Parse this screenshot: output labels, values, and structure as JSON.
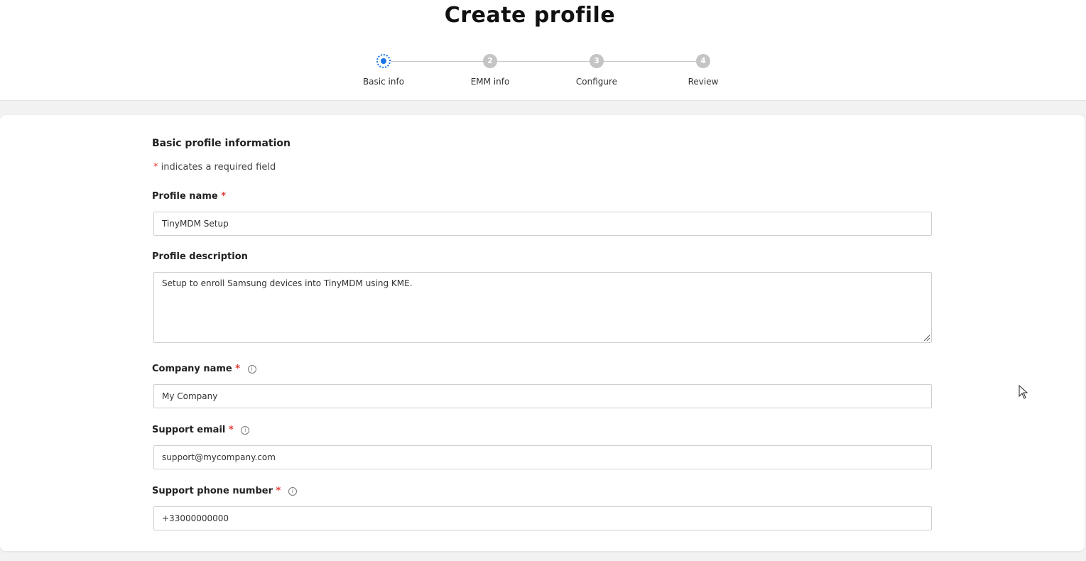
{
  "header": {
    "title": "Create profile"
  },
  "stepper": {
    "steps": [
      {
        "number": "1",
        "label": "Basic info",
        "active": true
      },
      {
        "number": "2",
        "label": "EMM info",
        "active": false
      },
      {
        "number": "3",
        "label": "Configure",
        "active": false
      },
      {
        "number": "4",
        "label": "Review",
        "active": false
      }
    ]
  },
  "form": {
    "section_title": "Basic profile information",
    "required_star": "*",
    "required_note": " indicates a required field",
    "fields": {
      "profile_name": {
        "label": "Profile name",
        "value": "TinyMDM Setup",
        "required": true
      },
      "profile_description": {
        "label": "Profile description",
        "value": "Setup to enroll Samsung devices into TinyMDM using KME.",
        "required": false
      },
      "company_name": {
        "label": "Company name",
        "value": "My Company",
        "required": true,
        "info_icon": "info-icon"
      },
      "support_email": {
        "label": "Support email",
        "value": "support@mycompany.com",
        "required": true,
        "info_icon": "info-icon"
      },
      "support_phone": {
        "label": "Support phone number",
        "value": "+33000000000",
        "required": true,
        "info_icon": "info-icon"
      }
    }
  },
  "colors": {
    "accent": "#1a73e8",
    "required": "#e53935",
    "inactive_step": "#c4c4c4"
  }
}
